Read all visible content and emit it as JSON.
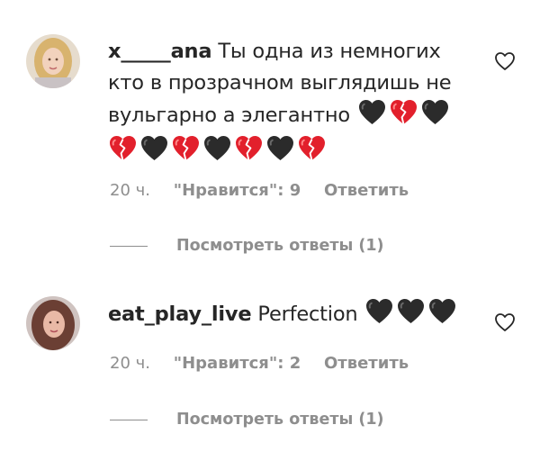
{
  "comments": [
    {
      "username": "x_____ana",
      "text_line1": "Ты одна из немногих",
      "text_line2": "кто в прозрачном выглядишь не",
      "text_line3": "вульгарно а элегантно",
      "emojis_line3": [
        "black-heart",
        "broken-heart",
        "black-heart"
      ],
      "emojis_line4": [
        "broken-heart",
        "black-heart",
        "broken-heart",
        "black-heart",
        "broken-heart",
        "black-heart",
        "broken-heart"
      ],
      "time": "20 ч.",
      "likes": "\"Нравится\": 9",
      "reply": "Ответить",
      "view_replies": "Посмотреть ответы (1)"
    },
    {
      "username": "eat_play_live",
      "text_line1": "Perfection",
      "emojis_line1": [
        "black-heart",
        "black-heart",
        "black-heart"
      ],
      "time": "20 ч.",
      "likes": "\"Нравится\": 2",
      "reply": "Ответить",
      "view_replies": "Посмотреть ответы (1)"
    }
  ],
  "colors": {
    "text": "#262626",
    "muted": "#8e8e8e",
    "broken_heart": "#e2202c",
    "black_heart": "#2b2b2b"
  }
}
